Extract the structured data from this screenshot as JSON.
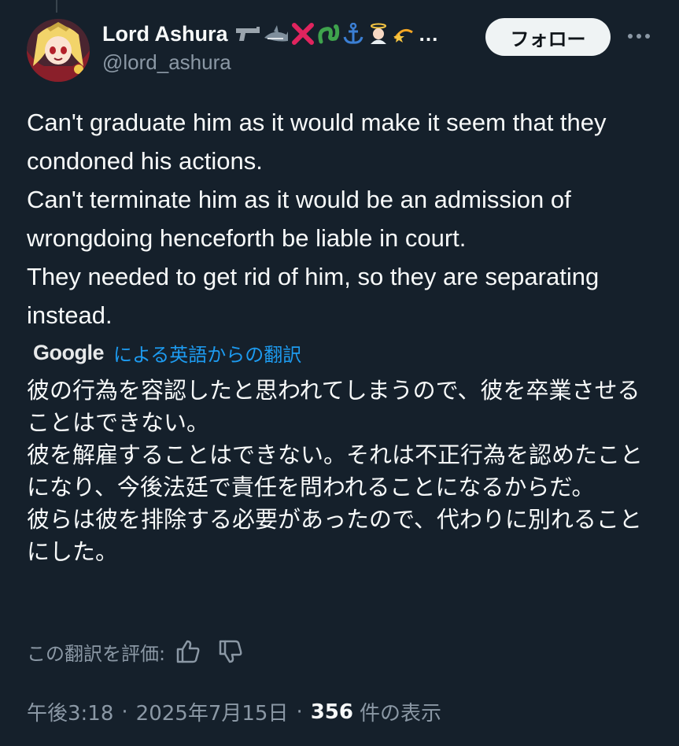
{
  "user": {
    "display_name": "Lord Ashura",
    "name_emojis": [
      "pistol-emoji",
      "shark-emoji",
      "cross-mark-emoji",
      "snake-emoji",
      "anchor-emoji",
      "angel-emoji",
      "dizzy-star-emoji"
    ],
    "name_ellipsis": "…",
    "handle": "@lord_ashura"
  },
  "follow_button": {
    "label": "フォロー"
  },
  "tweet": {
    "text": "Can't graduate him as it would make it seem that they condoned his actions.\nCan't terminate him as it would be an admission of wrongdoing henceforth be liable in court.\nThey needed to get rid of him, so they are separating instead."
  },
  "translation": {
    "provider": "Google",
    "link_label": "による英語からの翻訳",
    "text": "彼の行為を容認したと思われてしまうので、彼を卒業させることはできない。\n彼を解雇することはできない。それは不正行為を認めたことになり、今後法廷で責任を問われることになるからだ。\n彼らは彼を排除する必要があったので、代わりに別れることにした。",
    "rate_label": "この翻訳を評価:"
  },
  "meta": {
    "time": "午後3:18",
    "separator": "·",
    "date": "2025年7月15日",
    "views_count": "356",
    "views_label": "件の表示"
  },
  "colors": {
    "background": "#15202b",
    "text_primary": "#f7f9f9",
    "text_secondary": "#8b98a5",
    "link": "#1d9bf0",
    "follow_button_bg": "#eff3f4"
  }
}
